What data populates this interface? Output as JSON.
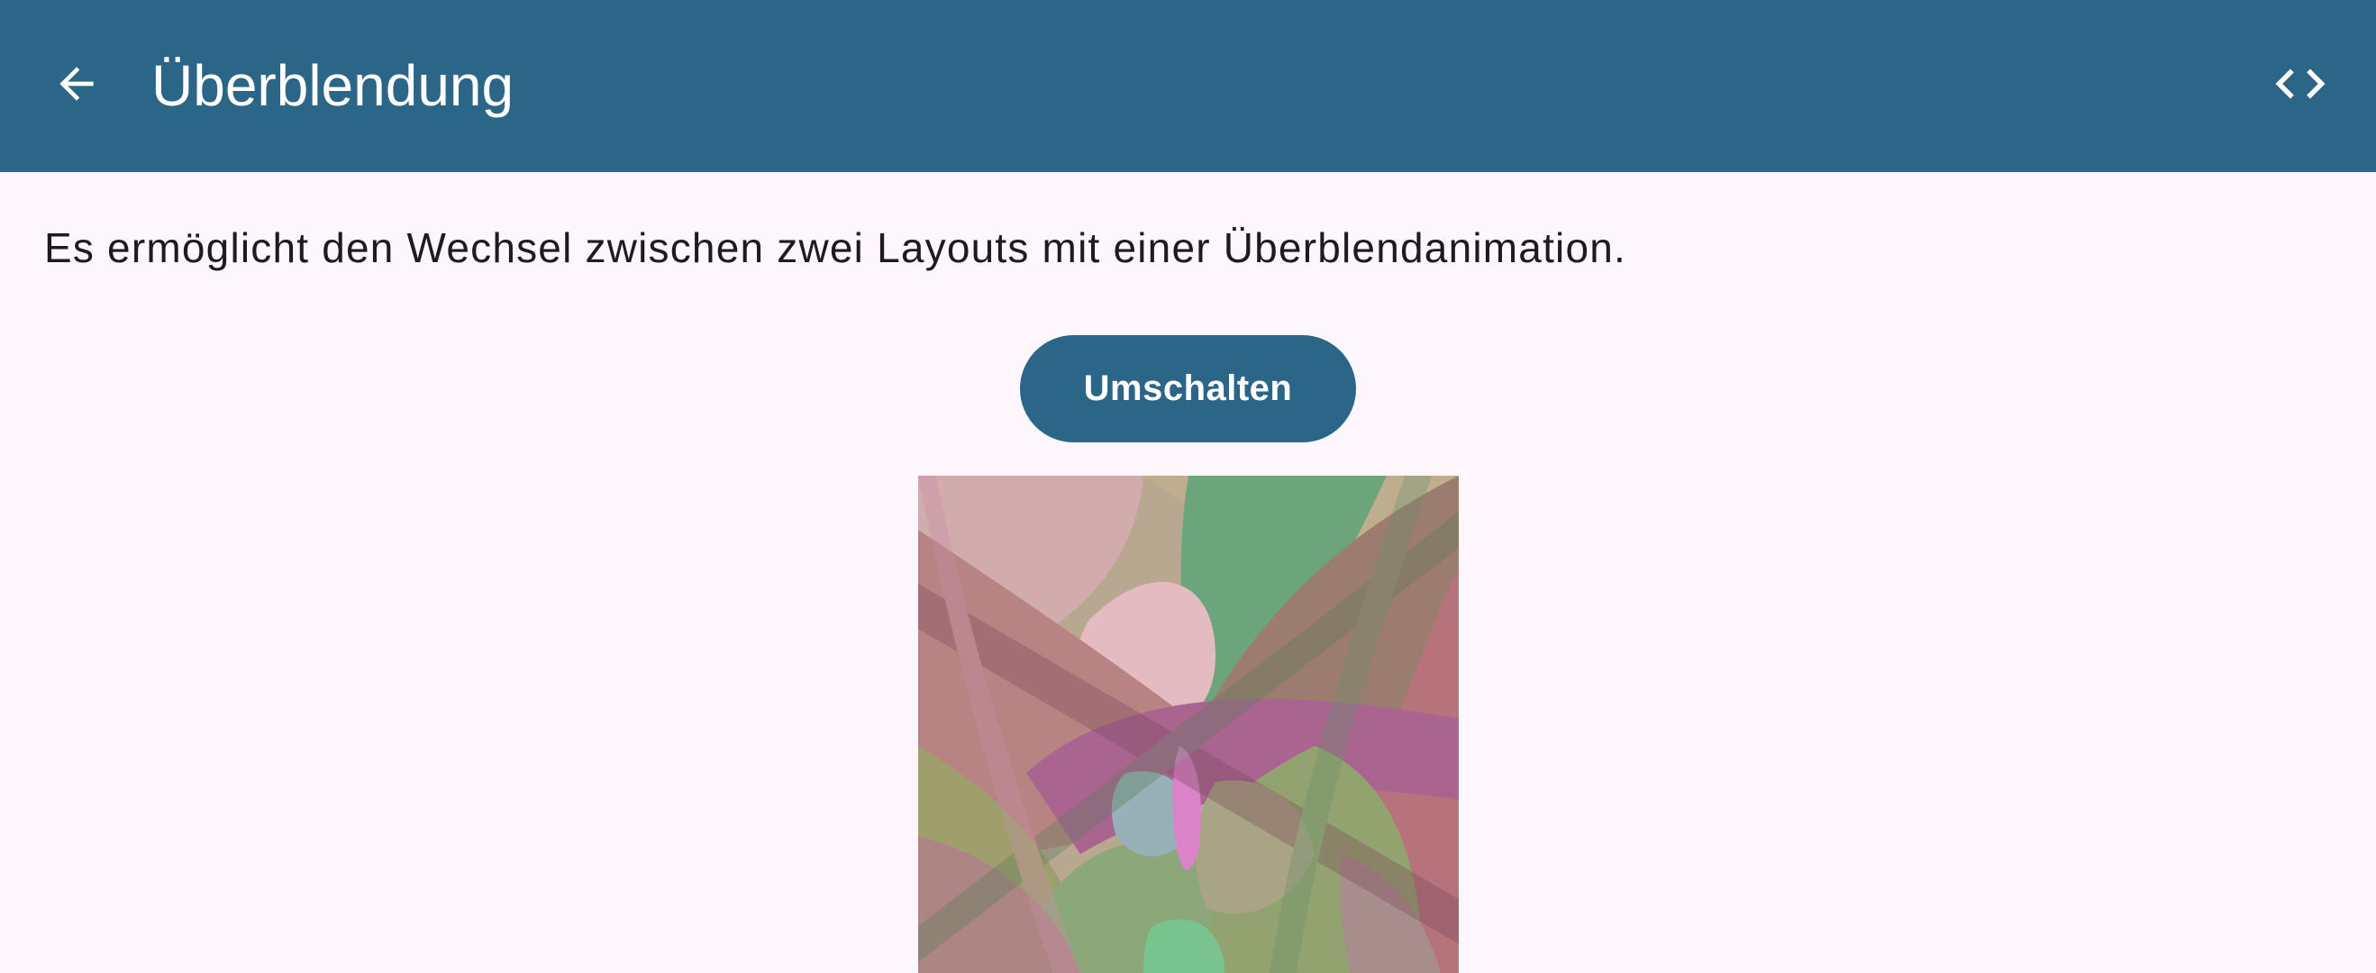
{
  "app_bar": {
    "title": "Überblendung",
    "back_icon": "arrow-back-icon",
    "code_icon": "code-icon",
    "background_color": "#2b6588"
  },
  "content": {
    "description": "Es ermöglicht den Wechsel zwischen zwei Layouts mit einer Überblendanimation.",
    "toggle_button_label": "Umschalten",
    "image": "abstract-colorful-shapes-image"
  },
  "colors": {
    "primary": "#2b6588",
    "background": "#fdf6fc",
    "on_surface": "#1d1b20"
  }
}
